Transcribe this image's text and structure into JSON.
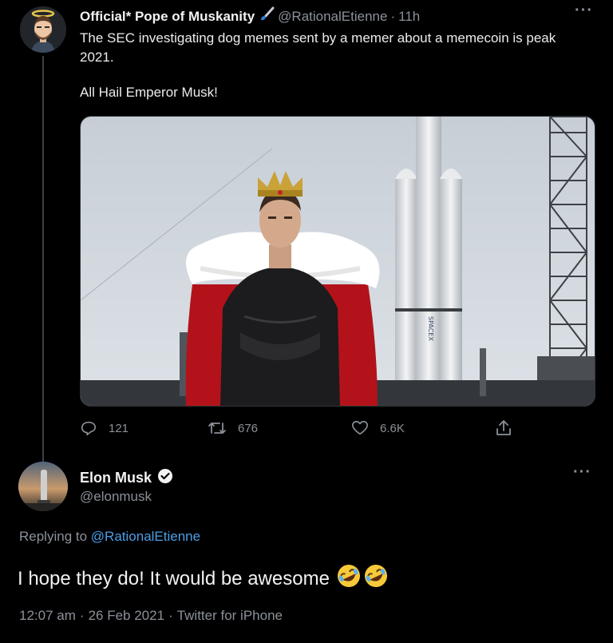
{
  "tweet1": {
    "name": "Official* Pope of Muskanity",
    "handle": "@RationalEtienne",
    "separator": "·",
    "time": "11h",
    "text": "The SEC investigating dog memes sent by a memer about a memecoin is peak 2021.",
    "text2": "All Hail Emperor Musk!",
    "rocket_text": "SPACEX",
    "stats": {
      "replies": "121",
      "retweets": "676",
      "likes": "6.6K"
    }
  },
  "tweet2": {
    "name": "Elon Musk",
    "handle": "@elonmusk",
    "replying_prefix": "Replying to",
    "replying_handle": "@RationalEtienne",
    "text": "I hope they do! It would be awesome",
    "time": "12:07 am",
    "date": "26 Feb 2021",
    "sep": "·",
    "source": "Twitter for iPhone"
  },
  "ui": {
    "more": "···"
  },
  "colors": {
    "accent": "#4b9fe6",
    "muted": "#8b9198",
    "background": "#000000"
  }
}
